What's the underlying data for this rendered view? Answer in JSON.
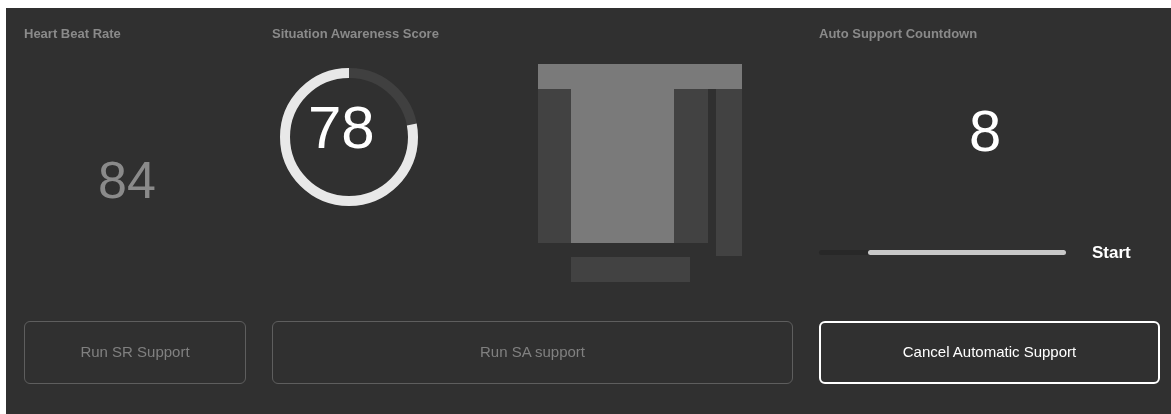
{
  "heart_rate": {
    "label": "Heart Beat Rate",
    "value": "84"
  },
  "awareness": {
    "label": "Situation Awareness Score",
    "value": "78",
    "level": 0.78
  },
  "countdown": {
    "label": "Auto Support Countdown",
    "value": "8",
    "level": 0.8,
    "action": "Start"
  },
  "buttons": [
    {
      "label": "Run SR Support",
      "disabled": true
    },
    {
      "label": "Run SA support",
      "disabled": true
    },
    {
      "label": "Cancel Automatic Support",
      "disabled": false
    }
  ]
}
